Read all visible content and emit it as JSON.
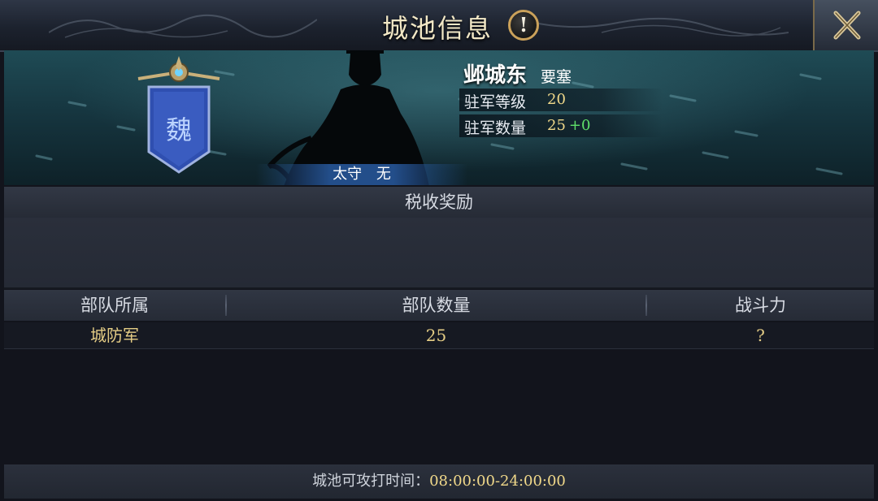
{
  "title": "城池信息",
  "icons": {
    "info": "exclamation-icon",
    "close": "crossed-swords-close-icon",
    "banner": "wei-faction-banner-icon"
  },
  "colors": {
    "accent_gold": "#f1d98a",
    "bonus_green": "#5fe06a",
    "faction_blue": "#2f4fb0"
  },
  "hero": {
    "faction_char": "魏",
    "city_name": "邺城东",
    "city_type": "要塞",
    "governor_label": "太守",
    "governor_value": "无",
    "stats": [
      {
        "label": "驻军等级",
        "value": "20",
        "bonus": ""
      },
      {
        "label": "驻军数量",
        "value": "25",
        "bonus": "+0"
      }
    ]
  },
  "tax": {
    "header": "税收奖励"
  },
  "table": {
    "columns": [
      "部队所属",
      "部队数量",
      "战斗力"
    ],
    "rows": [
      {
        "owner": "城防军",
        "count": "25",
        "power": "?"
      }
    ]
  },
  "footer": {
    "label": "城池可攻打时间：",
    "time": "08:00:00-24:00:00"
  }
}
